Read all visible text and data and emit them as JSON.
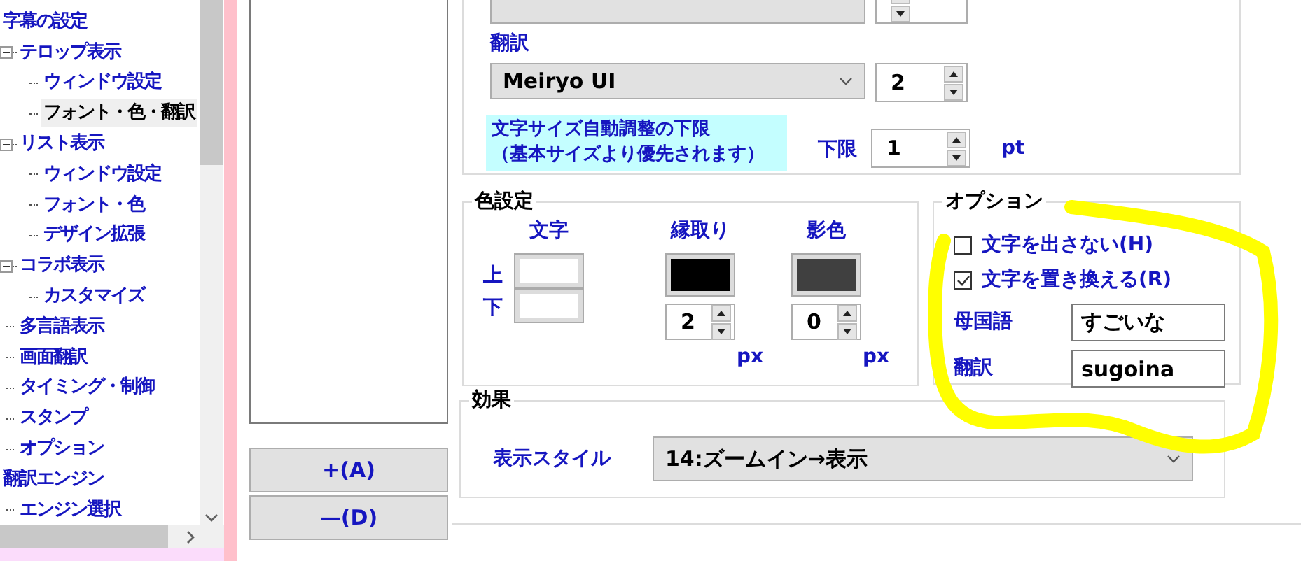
{
  "tree": {
    "items": [
      {
        "label": "字幕の設定",
        "selected": false,
        "children": [
          {
            "label": "テロップ表示",
            "selected": false,
            "expanded": true,
            "children": [
              {
                "label": "ウィンドウ設定",
                "selected": false
              },
              {
                "label": "フォント・色・翻訳",
                "selected": true
              }
            ]
          },
          {
            "label": "リスト表示",
            "selected": false,
            "expanded": true,
            "children": [
              {
                "label": "ウィンドウ設定",
                "selected": false
              },
              {
                "label": "フォント・色",
                "selected": false
              },
              {
                "label": "デザイン拡張",
                "selected": false
              }
            ]
          },
          {
            "label": "コラボ表示",
            "selected": false,
            "expanded": true,
            "children": [
              {
                "label": "カスタマイズ",
                "selected": false
              }
            ]
          },
          {
            "label": "多言語表示",
            "selected": false
          },
          {
            "label": "画面翻訳",
            "selected": false
          },
          {
            "label": "タイミング・制御",
            "selected": false
          },
          {
            "label": "スタンプ",
            "selected": false
          },
          {
            "label": "オプション",
            "selected": false
          }
        ]
      },
      {
        "label": "翻訳エンジン",
        "selected": false,
        "children": [
          {
            "label": "エンジン選択",
            "selected": false
          }
        ]
      }
    ]
  },
  "list_buttons": [
    "+(A)",
    "—(D)"
  ],
  "font_group": {
    "translation_label": "翻訳",
    "font_select": "Meiryo UI",
    "size": "2",
    "note_lines": [
      "文字サイズ自動調整の下限",
      "（基本サイズより優先されます）"
    ],
    "min_label": "下限",
    "min_value": "1",
    "min_unit": "pt"
  },
  "color_group": {
    "title": "色設定",
    "row_labels": [
      "上",
      "下"
    ],
    "columns": [
      {
        "title": "文字",
        "swatches": [
          {
            "color": "#ffffff"
          },
          {
            "color": "#ffffff"
          }
        ]
      },
      {
        "title": "縁取り",
        "swatches": [
          {
            "color": "#000000"
          }
        ],
        "value": "2",
        "unit": "px"
      },
      {
        "title": "影色",
        "swatches": [
          {
            "color": "#404040"
          }
        ],
        "value": "0",
        "unit": "px"
      }
    ]
  },
  "options_group": {
    "title": "オプション",
    "checkboxes": [
      {
        "label": "文字を出さない(H)",
        "checked": false
      },
      {
        "label": "文字を置き換える(R)",
        "checked": true
      }
    ],
    "fields": [
      {
        "label": "母国語",
        "value": "すごいな"
      },
      {
        "label": "翻訳",
        "value": "sugoina"
      }
    ]
  },
  "effect_group": {
    "title": "効果",
    "label": "表示スタイル",
    "select": "14:ズームイン→表示"
  }
}
